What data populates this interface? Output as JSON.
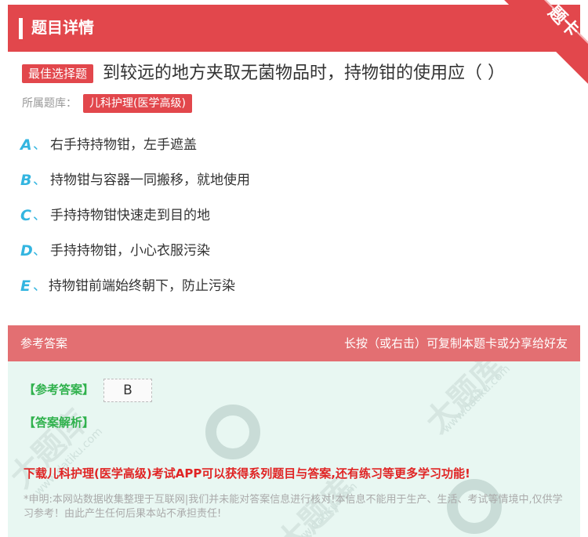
{
  "header": {
    "title": "题目详情",
    "corner_label": "题卡",
    "accent_color": "#e2474c"
  },
  "question": {
    "type_tag": "最佳选择题",
    "text": "到较远的地方夹取无菌物品时，持物钳的使用应（ ）",
    "bank_label": "所属题库：",
    "bank_name": "儿科护理(医学高级)"
  },
  "options": [
    {
      "letter": "A",
      "sep": "、",
      "text": "右手持持物钳，左手遮盖"
    },
    {
      "letter": "B",
      "sep": "、",
      "text": "持物钳与容器一同搬移，就地使用"
    },
    {
      "letter": "C",
      "sep": "、",
      "text": "手持持物钳快速走到目的地"
    },
    {
      "letter": "D",
      "sep": "、",
      "text": "手持持物钳，小心衣服污染"
    },
    {
      "letter": "E",
      "sep": "、",
      "text": "持物钳前端始终朝下，防止污染"
    }
  ],
  "answer_section": {
    "title": "参考答案",
    "hint": "长按（或右击）可复制本题卡或分享给好友",
    "answer_label": "【参考答案】",
    "answer_value": "B",
    "analysis_label": "【答案解析】",
    "promo": "下载儿科护理(医学高级)考试APP可以获得系列题目与答案,还有练习等更多学习功能!",
    "disclaimer": "*申明:本网站数据收集整理于互联网|我们并未能对答案信息进行核对!本信息不能用于生产、生活、考试等情境中,仅供学习参考！由此产生任何后果本站不承担责任!",
    "watermark_text": "大题库",
    "watermark_url": "www.datiku.com"
  }
}
